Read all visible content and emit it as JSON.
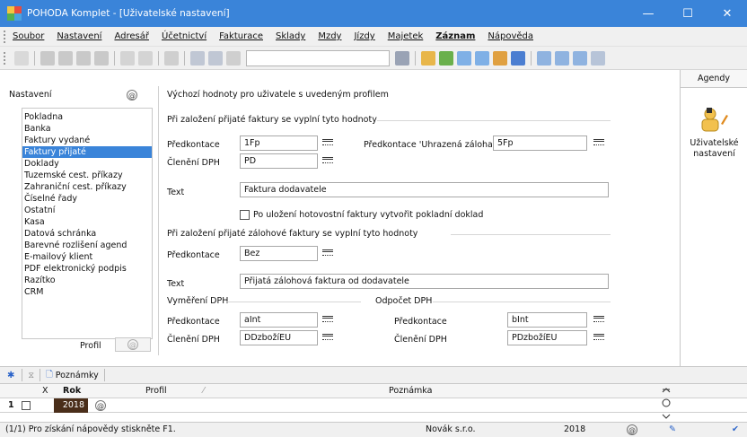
{
  "window": {
    "title": "POHODA Komplet - [Uživatelské nastavení]",
    "minimize": "—",
    "maximize": "☐",
    "close": "✕",
    "accent_color": "#3a84d9"
  },
  "menubar": {
    "items": [
      "Soubor",
      "Nastavení",
      "Adresář",
      "Účetnictví",
      "Fakturace",
      "Sklady",
      "Mzdy",
      "Jízdy",
      "Majetek",
      "Záznam",
      "Nápověda"
    ],
    "bold_item": "Záznam"
  },
  "left_panel": {
    "title": "Nastavení",
    "items": [
      "Pokladna",
      "Banka",
      "Faktury vydané",
      "Faktury přijaté",
      "Doklady",
      "Tuzemské cest. příkazy",
      "Zahraniční cest. příkazy",
      "Číselné řady",
      "Ostatní",
      "Kasa",
      "Datová schránka",
      "Barevné rozlišení agend",
      "E-mailový klient",
      "PDF elektronický podpis",
      "Razítko",
      "CRM"
    ],
    "selected_index": 3,
    "profil_label": "Profil"
  },
  "form": {
    "header": "Výchozí hodnoty pro uživatele s uvedeným profilem",
    "section1_title": "Při založení přijaté faktury se vyplní tyto hodnoty",
    "predkontace_label": "Předkontace",
    "predkontace_value": "1Fp",
    "predkontace_zaloha_label": "Předkontace 'Uhrazená záloha'",
    "predkontace_zaloha_value": "5Fp",
    "cleneni_label": "Členění DPH",
    "cleneni_value": "PD",
    "text_label": "Text",
    "text_value": "Faktura dodavatele",
    "checkbox_label": "Po uložení hotovostní faktury vytvořit pokladní doklad",
    "checkbox_checked": false,
    "section2_title": "Při založení přijaté zálohové faktury se vyplní tyto hodnoty",
    "zal_predkontace_label": "Předkontace",
    "zal_predkontace_value": "Bez",
    "zal_text_label": "Text",
    "zal_text_value": "Přijatá zálohová faktura od dodavatele",
    "vymereni_title": "Vyměření DPH",
    "odpocet_title": "Odpočet DPH",
    "vym_predkontace_label": "Předkontace",
    "vym_predkontace_value": "aInt",
    "vym_cleneni_label": "Členění DPH",
    "vym_cleneni_value": "DDzbožíEU",
    "odp_predkontace_label": "Předkontace",
    "odp_predkontace_value": "bInt",
    "odp_cleneni_label": "Členění DPH",
    "odp_cleneni_value": "PDzbožíEU"
  },
  "agendy": {
    "title": "Agendy",
    "item_label_line1": "Uživatelské",
    "item_label_line2": "nastavení"
  },
  "bottom": {
    "tab_label": "Poznámky",
    "columns": {
      "x": "X",
      "rok": "Rok",
      "profil": "Profil",
      "poznamka": "Poznámka"
    },
    "row": {
      "num": "1",
      "rok": "2018"
    }
  },
  "status": {
    "help": "(1/1) Pro získání nápovědy stiskněte F1.",
    "company": "Novák s.r.o.",
    "year": "2018"
  }
}
